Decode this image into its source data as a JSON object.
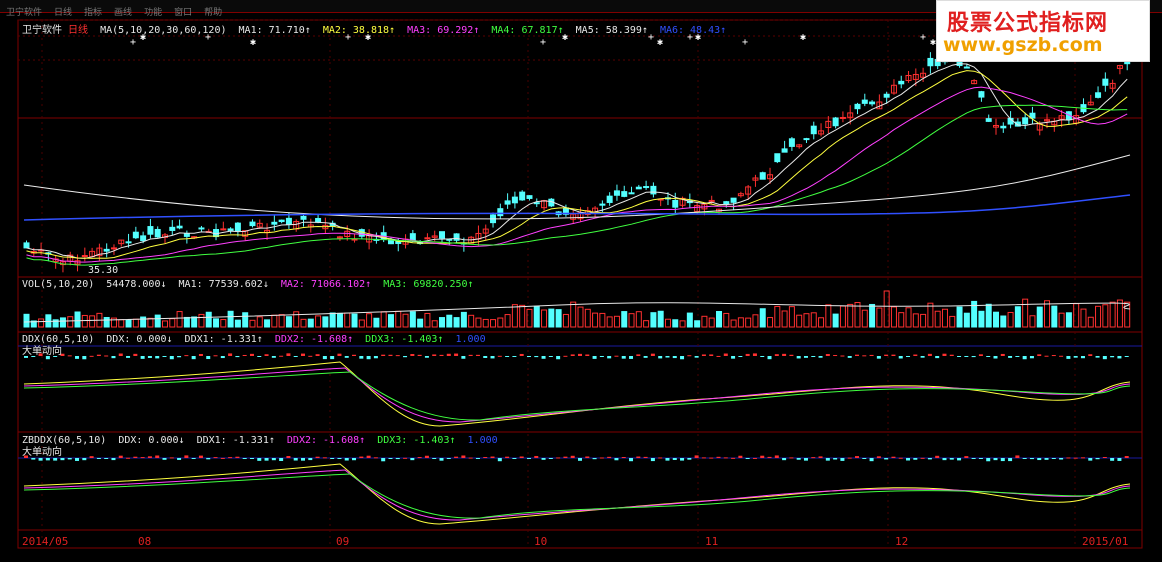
{
  "watermark": {
    "line1": "股票公式指标网",
    "line2": "www.gszb.com"
  },
  "menubar": {
    "items": [
      "卫宁软件",
      "日线",
      "指标",
      "画线",
      "功能",
      "窗口",
      "帮助"
    ]
  },
  "main_panel": {
    "stock_name": "卫宁软件",
    "period": "日线",
    "indicator": "MA(5,10,20,30,60,120)",
    "ma1": "MA1: 71.710↑",
    "ma2": "MA2: 38.818↑",
    "ma3": "MA3: 69.292↑",
    "ma4": "MA4: 67.817↑",
    "ma5": "MA5: 58.399↑",
    "ma6": "MA6: 48.43↑",
    "low_label": "35.30"
  },
  "vol_panel": {
    "indicator": "VOL(5,10,20)",
    "vol": "54478.000↓",
    "ma1": "MA1: 77539.602↓",
    "ma2": "MA2: 71066.102↑",
    "ma3": "MA3: 69820.250↑"
  },
  "ddx_panel": {
    "indicator": "DDX(60,5,10)",
    "ddx": "DDX: 0.000↓",
    "ddx1": "DDX1: -1.331↑",
    "ddx2": "DDX2: -1.608↑",
    "ddx3": "DDX3: -1.403↑",
    "extra": "1.000",
    "title": "大单动向"
  },
  "zbddx_panel": {
    "indicator": "ZBDDX(60,5,10)",
    "ddx": "DDX: 0.000↓",
    "ddx1": "DDX1: -1.331↑",
    "ddx2": "DDX2: -1.608↑",
    "ddx3": "DDX3: -1.403↑",
    "extra": "1.000",
    "title": "大单动向"
  },
  "dates": [
    "2014/05",
    "08",
    "09",
    "10",
    "11",
    "12",
    "2015/01"
  ],
  "colors": {
    "up": "#ff3030",
    "down": "#54ffff",
    "ma5": "#e8e8e8",
    "ma10": "#ffff40",
    "ma20": "#ff40ff",
    "ma30": "#40ff40",
    "ma60": "#ededed",
    "ma120": "#3050ff",
    "grid": "#800000"
  },
  "chart_data": {
    "type": "candlestick",
    "series_count": 6,
    "ma_periods": [
      5,
      10,
      20,
      30,
      60,
      120
    ],
    "last_values": {
      "MA1": 71.71,
      "MA2": 38.818,
      "MA3": 69.292,
      "MA4": 67.817,
      "MA5": 58.399
    },
    "min_price_label": 35.3,
    "x_labels": [
      "2014/05",
      "08",
      "09",
      "10",
      "11",
      "12",
      "2015/01"
    ]
  }
}
